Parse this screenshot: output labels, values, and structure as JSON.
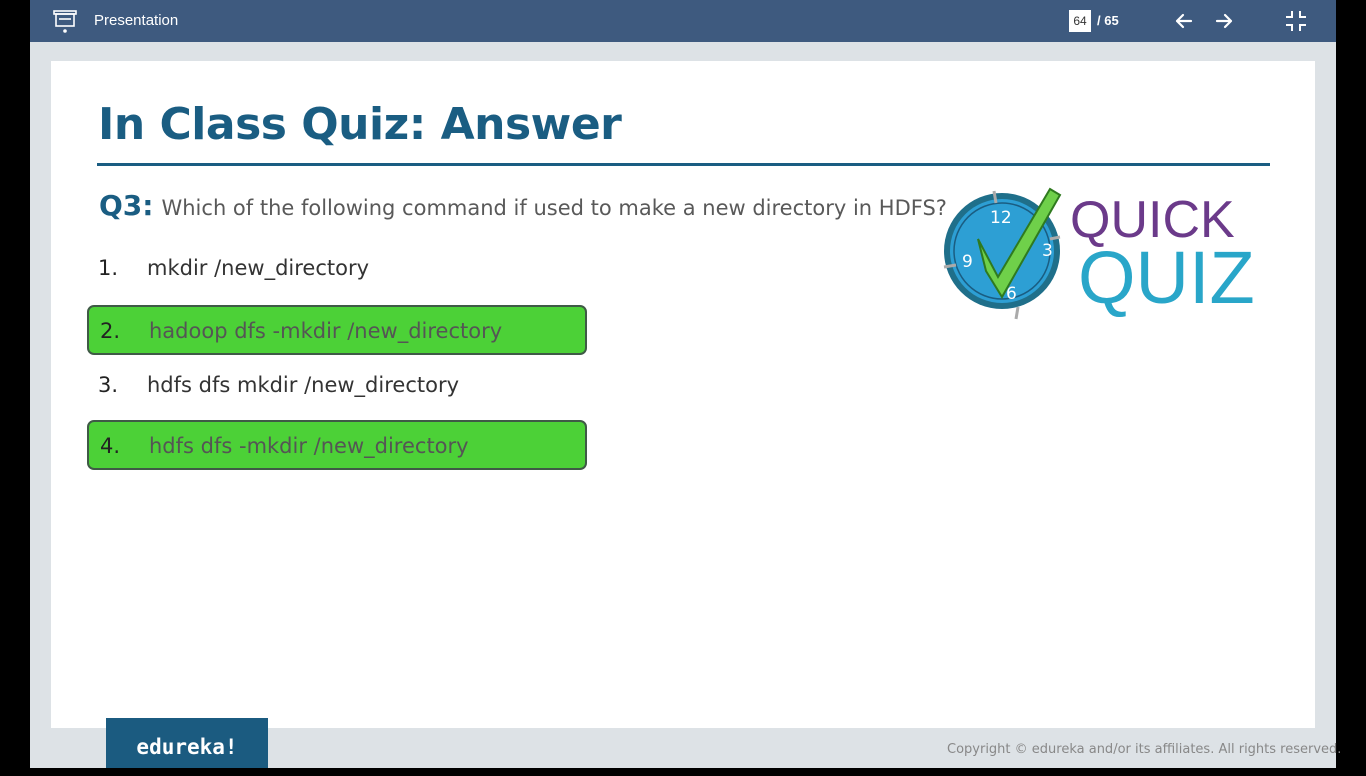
{
  "header": {
    "app_title": "Presentation",
    "current_page": "64",
    "page_total": "/ 65"
  },
  "slide": {
    "title": "In Class Quiz: Answer",
    "question_label": "Q3:",
    "question_text": "Which of the following command if used to make a new directory in HDFS?",
    "options": [
      {
        "number": "1.",
        "text": "mkdir /new_directory",
        "correct": false
      },
      {
        "number": "2.",
        "text": "hadoop dfs -mkdir /new_directory",
        "correct": true
      },
      {
        "number": "3.",
        "text": "hdfs dfs mkdir /new_directory",
        "correct": false
      },
      {
        "number": "4.",
        "text": "hdfs dfs -mkdir /new_directory",
        "correct": true
      }
    ],
    "logo": {
      "word1": "QUICK",
      "word2": "QUIZ",
      "clock_numbers": [
        "12",
        "3",
        "6",
        "9"
      ]
    }
  },
  "footer": {
    "brand": "edureka!",
    "copyright": "Copyright © edureka and/or its affiliates. All rights reserved."
  },
  "colors": {
    "topbar": "#3e5a7f",
    "title_blue": "#1a5d82",
    "correct_green": "#4cd137",
    "logo_purple": "#6b3a8a",
    "logo_cyan": "#29a6c9"
  }
}
